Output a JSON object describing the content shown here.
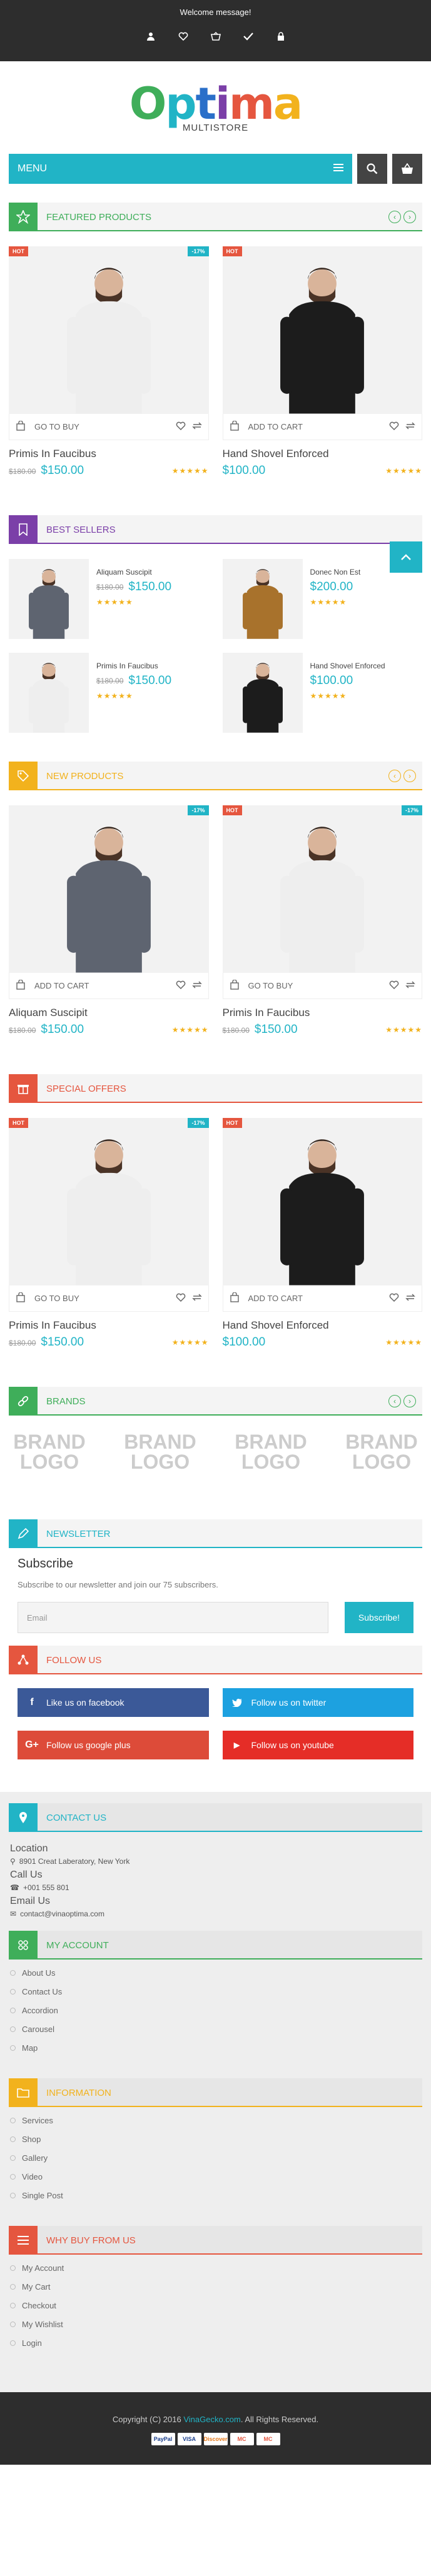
{
  "topbar": {
    "welcome": "Welcome message!"
  },
  "logo": {
    "brand": "Optima",
    "sub": "MULTISTORE"
  },
  "menu": {
    "label": "MENU"
  },
  "colors": {
    "accent": "#21b4c6",
    "green": "#3fae5a",
    "purple": "#7b3fa8",
    "yellow": "#f2b21d",
    "red": "#e5563f",
    "dark": "#2d2d2d"
  },
  "featured": {
    "title": "FEATURED PRODUCTS",
    "products": [
      {
        "name": "Primis In Faucibus",
        "old_price": "$180.00",
        "price": "$150.00",
        "action": "GO TO BUY",
        "hot": "HOT",
        "pct": "-17%"
      },
      {
        "name": "Hand Shovel Enforced",
        "old_price": "",
        "price": "$100.00",
        "action": "ADD TO CART",
        "hot": "HOT",
        "pct": ""
      }
    ]
  },
  "best": {
    "title": "BEST SELLERS",
    "items": [
      {
        "name": "Aliquam Suscipit",
        "old_price": "$180.00",
        "price": "$150.00"
      },
      {
        "name": "Donec Non Est",
        "old_price": "",
        "price": "$200.00"
      },
      {
        "name": "Primis In Faucibus",
        "old_price": "$180.00",
        "price": "$150.00"
      },
      {
        "name": "Hand Shovel Enforced",
        "old_price": "",
        "price": "$100.00"
      }
    ]
  },
  "newp": {
    "title": "NEW PRODUCTS",
    "products": [
      {
        "name": "Aliquam Suscipit",
        "old_price": "$180.00",
        "price": "$150.00",
        "action": "ADD TO CART",
        "hot": "",
        "pct": "-17%"
      },
      {
        "name": "Primis In Faucibus",
        "old_price": "$180.00",
        "price": "$150.00",
        "action": "GO TO BUY",
        "hot": "HOT",
        "pct": "-17%"
      }
    ]
  },
  "special": {
    "title": "SPECIAL OFFERS",
    "products": [
      {
        "name": "Primis In Faucibus",
        "old_price": "$180.00",
        "price": "$150.00",
        "action": "GO TO BUY",
        "hot": "HOT",
        "pct": "-17%"
      },
      {
        "name": "Hand Shovel Enforced",
        "old_price": "",
        "price": "$100.00",
        "action": "ADD TO CART",
        "hot": "HOT",
        "pct": ""
      }
    ]
  },
  "brands": {
    "title": "BRANDS",
    "logos": [
      "BRAND LOGO",
      "BRAND LOGO",
      "BRAND LOGO",
      "BRAND LOGO"
    ]
  },
  "newsletter": {
    "title": "NEWSLETTER",
    "heading": "Subscribe",
    "text": "Subscribe to our newsletter and join our 75 subscribers.",
    "placeholder": "Email",
    "button": "Subscribe!"
  },
  "follow": {
    "title": "FOLLOW US",
    "buttons": [
      {
        "label": "Like us on facebook",
        "icon": "f",
        "color": "#3b5998"
      },
      {
        "label": "Follow us on twitter",
        "icon": "t",
        "color": "#1da1e0"
      },
      {
        "label": "Follow us google plus",
        "icon": "G+",
        "color": "#dd4b39"
      },
      {
        "label": "Follow us on youtube",
        "icon": "▶",
        "color": "#e52d27"
      }
    ]
  },
  "contact": {
    "title": "CONTACT US",
    "location_label": "Location",
    "location": "8901 Creat Laberatory, New York",
    "call_label": "Call Us",
    "phone": "+001 555 801",
    "email_label": "Email Us",
    "email": "contact@vinaoptima.com"
  },
  "account": {
    "title": "MY ACCOUNT",
    "links": [
      "About Us",
      "Contact Us",
      "Accordion",
      "Carousel",
      "Map"
    ]
  },
  "information": {
    "title": "INFORMATION",
    "links": [
      "Services",
      "Shop",
      "Gallery",
      "Video",
      "Single Post"
    ]
  },
  "whybuy": {
    "title": "WHY BUY FROM US",
    "links": [
      "My Account",
      "My Cart",
      "Checkout",
      "My Wishlist",
      "Login"
    ]
  },
  "bottom": {
    "copyright_pre": "Copyright (C) 2016 ",
    "vinagecko": "VinaGecko.com",
    "copyright_post": ". All Rights Reserved.",
    "cards": [
      "PayPal",
      "VISA",
      "Discover",
      "MC",
      "MC"
    ]
  },
  "stars": "★★★★★"
}
